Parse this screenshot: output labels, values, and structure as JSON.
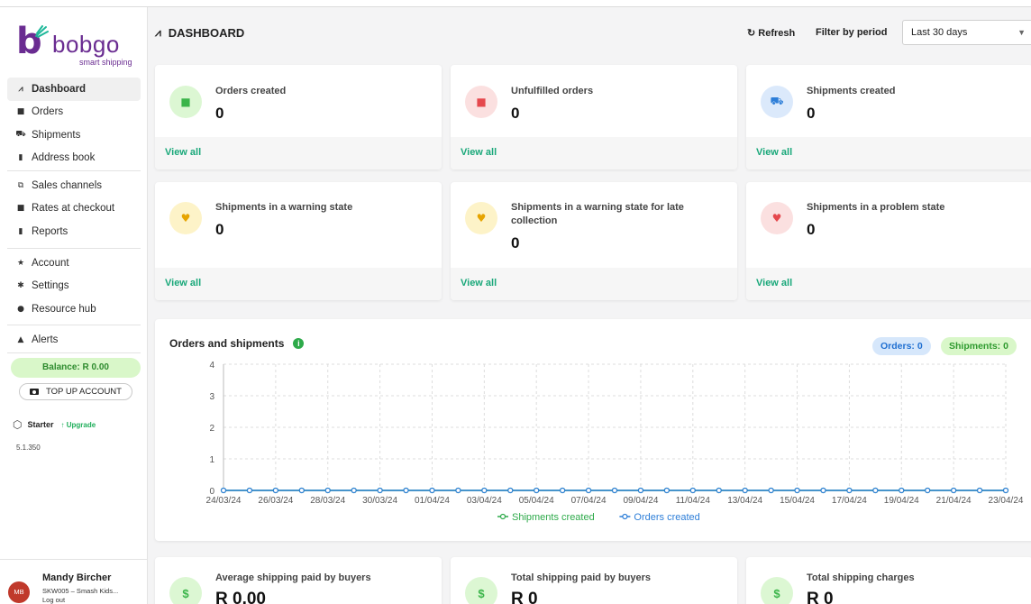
{
  "brand": {
    "name": "bobgo",
    "tagline": "smart shipping",
    "color": "#6a2c91"
  },
  "sidebar": {
    "groups": [
      [
        {
          "label": "Dashboard",
          "icon": "chart-line-icon",
          "glyph": "⩘",
          "active": true
        },
        {
          "label": "Orders",
          "icon": "shopping-bag-icon",
          "glyph": "■"
        },
        {
          "label": "Shipments",
          "icon": "truck-icon",
          "glyph": "⛟"
        },
        {
          "label": "Address book",
          "icon": "address-book-icon",
          "glyph": "▮"
        }
      ],
      [
        {
          "label": "Sales channels",
          "icon": "sitemap-icon",
          "glyph": "⧉"
        },
        {
          "label": "Rates at checkout",
          "icon": "cart-icon",
          "glyph": "■"
        },
        {
          "label": "Reports",
          "icon": "report-icon",
          "glyph": "▮"
        }
      ],
      [
        {
          "label": "Account",
          "icon": "star-icon",
          "glyph": "★"
        },
        {
          "label": "Settings",
          "icon": "gear-icon",
          "glyph": "✱"
        },
        {
          "label": "Resource hub",
          "icon": "info-icon",
          "glyph": "●"
        }
      ],
      [
        {
          "label": "Alerts",
          "icon": "bell-icon",
          "glyph": "▲"
        }
      ]
    ],
    "balance": "Balance: R 0.00",
    "topup": "TOP UP ACCOUNT",
    "plan": {
      "name": "Starter",
      "upgrade": "↑ Upgrade"
    },
    "version": "5.1.350",
    "user": {
      "initials": "MB",
      "name": "Mandy Bircher",
      "shop": "SKW005 – Smash Kids...",
      "logout": "Log out"
    }
  },
  "header": {
    "title": "DASHBOARD",
    "refresh": "Refresh",
    "filter_label": "Filter by period",
    "period": "Last 30 days"
  },
  "cards": [
    {
      "title": "Orders created",
      "value": "0",
      "link": "View all",
      "tone": "green",
      "icon": "shopping-bag-icon",
      "glyph": "■"
    },
    {
      "title": "Unfulfilled orders",
      "value": "0",
      "link": "View all",
      "tone": "red",
      "icon": "shopping-bag-icon",
      "glyph": "■"
    },
    {
      "title": "Shipments created",
      "value": "0",
      "link": "View all",
      "tone": "blue",
      "icon": "truck-icon",
      "glyph": "⛟"
    },
    {
      "title": "Shipments in a warning state",
      "value": "0",
      "link": "View all",
      "tone": "yellow",
      "icon": "heartbeat-icon",
      "glyph": "♥"
    },
    {
      "title": "Shipments in a warning state for late collection",
      "value": "0",
      "link": "View all",
      "tone": "yellow",
      "icon": "heartbeat-icon",
      "glyph": "♥"
    },
    {
      "title": "Shipments in a problem state",
      "value": "0",
      "link": "View all",
      "tone": "red",
      "icon": "heartbeat-icon",
      "glyph": "♥"
    }
  ],
  "orders_shipments": {
    "title": "Orders and shipments",
    "orders_pill": "Orders: 0",
    "shipments_pill": "Shipments: 0"
  },
  "chart_data": {
    "type": "line",
    "title": "Orders and shipments",
    "x": [
      "24/03/24",
      "25/03/24",
      "26/03/24",
      "27/03/24",
      "28/03/24",
      "29/03/24",
      "30/03/24",
      "31/03/24",
      "01/04/24",
      "02/04/24",
      "03/04/24",
      "04/04/24",
      "05/04/24",
      "06/04/24",
      "07/04/24",
      "08/04/24",
      "09/04/24",
      "10/04/24",
      "11/04/24",
      "12/04/24",
      "13/04/24",
      "14/04/24",
      "15/04/24",
      "16/04/24",
      "17/04/24",
      "18/04/24",
      "19/04/24",
      "20/04/24",
      "21/04/24",
      "22/04/24",
      "23/04/24"
    ],
    "tick_labels": [
      "24/03/24",
      "26/03/24",
      "28/03/24",
      "30/03/24",
      "01/04/24",
      "03/04/24",
      "05/04/24",
      "07/04/24",
      "09/04/24",
      "11/04/24",
      "13/04/24",
      "15/04/24",
      "17/04/24",
      "19/04/24",
      "21/04/24",
      "23/04/24"
    ],
    "series": [
      {
        "name": "Shipments created",
        "color": "#2eaa4a",
        "values": [
          0,
          0,
          0,
          0,
          0,
          0,
          0,
          0,
          0,
          0,
          0,
          0,
          0,
          0,
          0,
          0,
          0,
          0,
          0,
          0,
          0,
          0,
          0,
          0,
          0,
          0,
          0,
          0,
          0,
          0,
          0
        ]
      },
      {
        "name": "Orders created",
        "color": "#2d7ed8",
        "values": [
          0,
          0,
          0,
          0,
          0,
          0,
          0,
          0,
          0,
          0,
          0,
          0,
          0,
          0,
          0,
          0,
          0,
          0,
          0,
          0,
          0,
          0,
          0,
          0,
          0,
          0,
          0,
          0,
          0,
          0,
          0
        ]
      }
    ],
    "ylim": [
      0,
      4
    ],
    "yticks": [
      "0",
      "1",
      "2",
      "3",
      "4"
    ],
    "grid": true,
    "legend": "bottom-center"
  },
  "bottom_cards": [
    {
      "title": "Average shipping paid by buyers",
      "value": "R 0.00",
      "glyph": "$"
    },
    {
      "title": "Total shipping paid by buyers",
      "value": "R 0",
      "glyph": "$"
    },
    {
      "title": "Total shipping charges",
      "value": "R 0",
      "glyph": "$"
    }
  ]
}
